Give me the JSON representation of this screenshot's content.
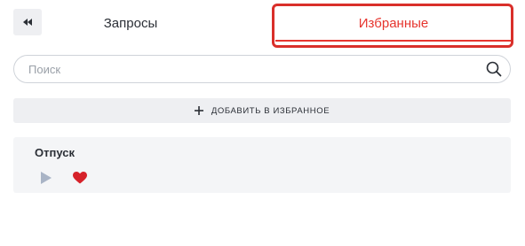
{
  "collapse_button": {
    "icon": "double-chevron-left-icon"
  },
  "tabs": [
    {
      "label": "Запросы",
      "active": false
    },
    {
      "label": "Избранные",
      "active": true
    }
  ],
  "search": {
    "placeholder": "Поиск",
    "value": "",
    "icon": "search-icon"
  },
  "add_favorite": {
    "label": "ДОБАВИТЬ В ИЗБРАННОЕ",
    "icon": "plus-icon"
  },
  "favorites": [
    {
      "title": "Отпуск",
      "play_icon": "play-icon",
      "favorite_icon": "heart-icon"
    }
  ],
  "colors": {
    "accent": "#e6352e",
    "highlight_border": "#d92f2a",
    "panel_bg": "#eeeff2",
    "card_bg": "#f4f5f7",
    "text": "#2b2f36",
    "muted": "#9aa0a8",
    "play_icon": "#a9b4c6",
    "heart_icon": "#d6222a"
  }
}
